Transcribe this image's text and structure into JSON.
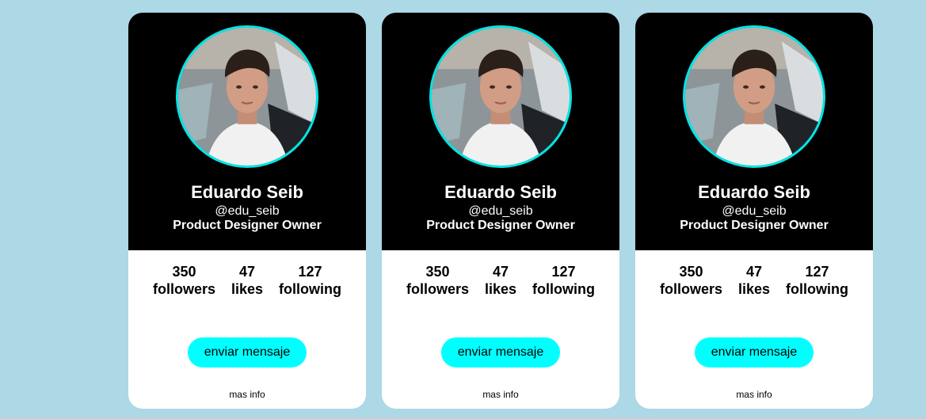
{
  "colors": {
    "background": "#add8e6",
    "card_header": "#000000",
    "avatar_ring": "#00e5e5",
    "button": "#00ffff"
  },
  "cards": [
    {
      "name": "Eduardo Seib",
      "handle": "@edu_seib",
      "role": "Product Designer Owner",
      "stats": [
        {
          "value": "350",
          "label": "followers"
        },
        {
          "value": "47",
          "label": "likes"
        },
        {
          "value": "127",
          "label": "following"
        }
      ],
      "button_label": "enviar mensaje",
      "link_label": "mas info"
    },
    {
      "name": "Eduardo Seib",
      "handle": "@edu_seib",
      "role": "Product Designer Owner",
      "stats": [
        {
          "value": "350",
          "label": "followers"
        },
        {
          "value": "47",
          "label": "likes"
        },
        {
          "value": "127",
          "label": "following"
        }
      ],
      "button_label": "enviar mensaje",
      "link_label": "mas info"
    },
    {
      "name": "Eduardo Seib",
      "handle": "@edu_seib",
      "role": "Product Designer Owner",
      "stats": [
        {
          "value": "350",
          "label": "followers"
        },
        {
          "value": "47",
          "label": "likes"
        },
        {
          "value": "127",
          "label": "following"
        }
      ],
      "button_label": "enviar mensaje",
      "link_label": "mas info"
    }
  ]
}
